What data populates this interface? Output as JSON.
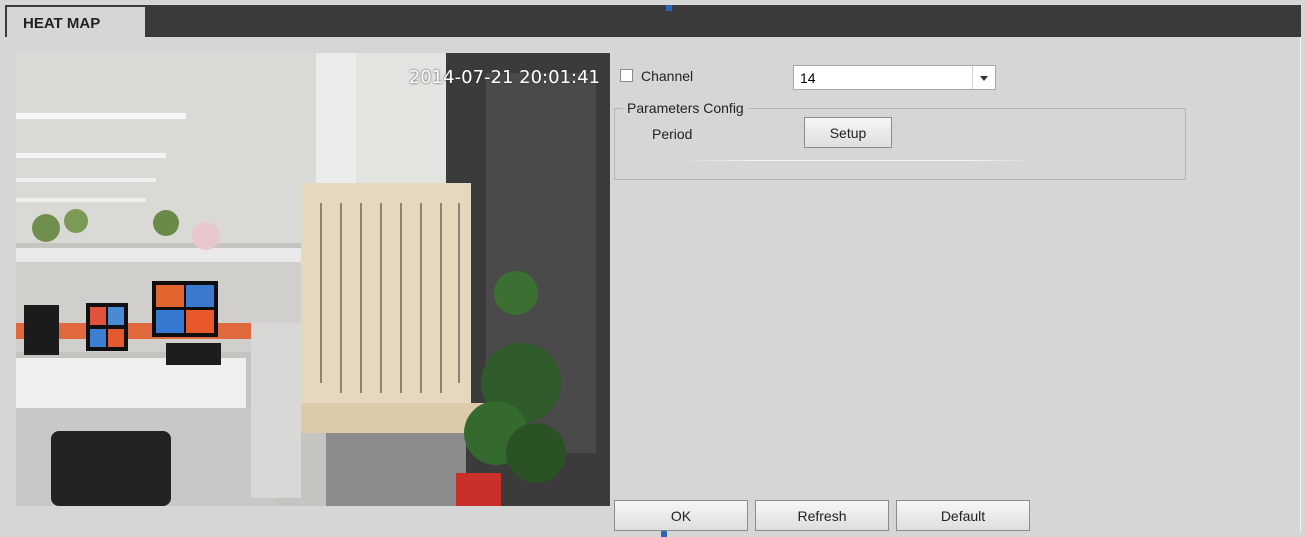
{
  "tab": {
    "label": "HEAT MAP"
  },
  "video": {
    "timestamp": "2014-07-21 20:01:41"
  },
  "channel": {
    "label": "Channel",
    "checked": false,
    "selected": "14"
  },
  "parameters": {
    "legend": "Parameters Config",
    "period_label": "Period",
    "setup_label": "Setup"
  },
  "footer": {
    "ok_label": "OK",
    "refresh_label": "Refresh",
    "default_label": "Default"
  },
  "colors": {
    "topbar": "#3a3a3a",
    "panel": "#d6d6d6",
    "accent": "#2f66b3"
  }
}
